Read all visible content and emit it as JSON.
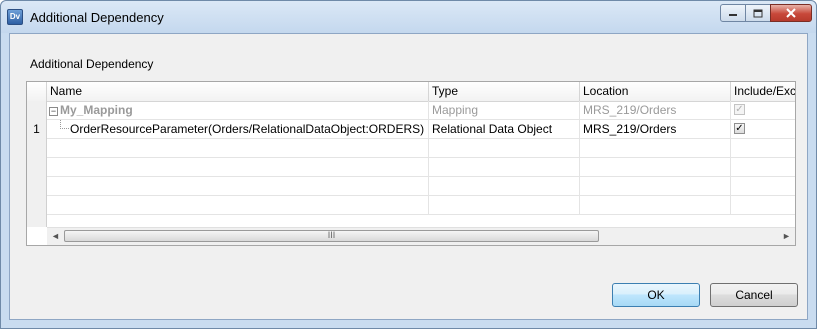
{
  "window": {
    "title": "Additional Dependency",
    "app_icon_text": "Dv",
    "icon": "dv-app-icon"
  },
  "dialog": {
    "section_label": "Additional Dependency",
    "columns": {
      "name": "Name",
      "type": "Type",
      "location": "Location",
      "include": "Include/Exc"
    },
    "rows": [
      {
        "num": "",
        "expander": "⊟",
        "name": "My_Mapping",
        "type": "Mapping",
        "location": "MRS_219/Orders",
        "include": true,
        "disabled": true
      },
      {
        "num": "1",
        "name": "OrderResourceParameter(Orders/RelationalDataObject:ORDERS)",
        "type": "Relational Data Object",
        "location": "MRS_219/Orders",
        "include": true,
        "disabled": false
      }
    ],
    "scroll_grip": "III",
    "buttons": {
      "ok": "OK",
      "cancel": "Cancel"
    }
  },
  "colors": {
    "title_gradient_top": "#dbe8f6",
    "close_button": "#c8483a",
    "default_button_border": "#3c7fb1"
  }
}
